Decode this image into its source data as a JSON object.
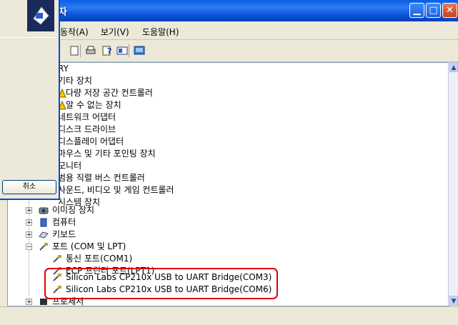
{
  "window": {
    "title": "리자",
    "controls": [
      "minimize",
      "maximize",
      "close"
    ]
  },
  "menu": {
    "items": [
      "동작(A)",
      "보기(V)",
      "도움말(H)"
    ]
  },
  "toolbar": {
    "icons": [
      "properties-icon",
      "print-icon",
      "help-icon",
      "view-icon",
      "device-icon"
    ]
  },
  "tree": {
    "items": [
      {
        "label": "RY",
        "level": 0
      },
      {
        "label": "기타 장치",
        "level": 1
      },
      {
        "label": "다량 저장 공간 컨트롤러",
        "level": 2
      },
      {
        "label": "알 수 없는 장치",
        "level": 2
      },
      {
        "label": "네트워크 어댑터",
        "level": 1
      },
      {
        "label": "디스크 드라이브",
        "level": 1
      },
      {
        "label": "디스플레이 어댑터",
        "level": 1
      },
      {
        "label": "마우스 및 기타 포인팅 장치",
        "level": 1
      },
      {
        "label": "모니터",
        "level": 1
      },
      {
        "label": "범용 직렬 버스 컨트롤러",
        "level": 1
      },
      {
        "label": "사운드, 비디오 및 게임 컨트롤러",
        "level": 1
      },
      {
        "label": "시스템 장치",
        "level": 1
      },
      {
        "label": "이미징 장치",
        "level": 1
      },
      {
        "label": "컴퓨터",
        "level": 1
      },
      {
        "label": "키보드",
        "level": 1
      },
      {
        "label": "포트 (COM 및 LPT)",
        "level": 1
      },
      {
        "label": "통신 포트(COM1)",
        "level": 2
      },
      {
        "label": "ECP 프린터 포트(LPT1)",
        "level": 2
      },
      {
        "label": "Silicon Labs CP210x USB to UART Bridge(COM3)",
        "level": 2
      },
      {
        "label": "Silicon Labs CP210x USB to UART Bridge(COM6)",
        "level": 2
      },
      {
        "label": "프로세서",
        "level": 1
      }
    ]
  },
  "dialog": {
    "cancel_label": "취소"
  },
  "colors": {
    "titlebar": "#0a5ee4",
    "highlight": "#e00000"
  }
}
